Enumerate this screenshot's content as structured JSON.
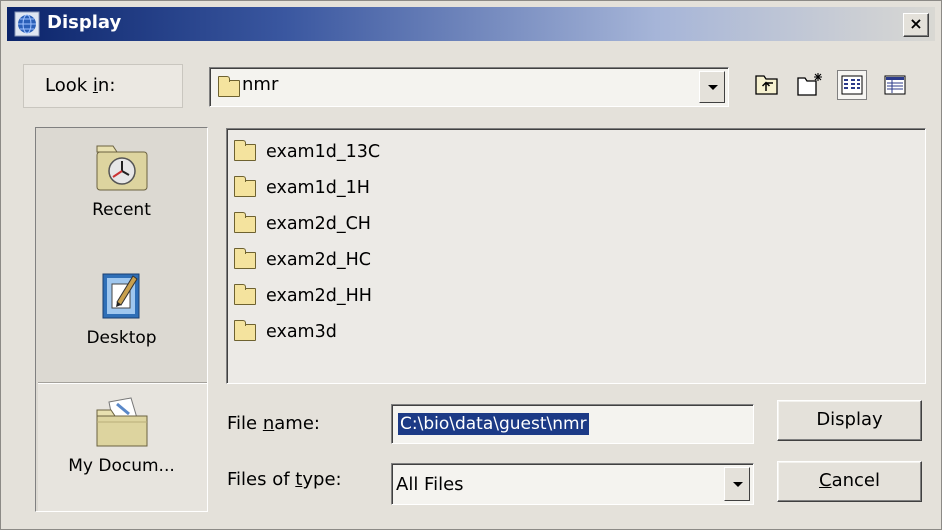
{
  "window": {
    "title": "Display",
    "close_label": "×"
  },
  "look_in": {
    "label_pre": "Look ",
    "label_mnemonic": "i",
    "label_post": "n:",
    "value": "nmr"
  },
  "toolbar": {
    "icons": [
      "up-one-level-icon",
      "create-new-folder-icon",
      "list-view-icon",
      "details-view-icon"
    ]
  },
  "places": [
    {
      "label": "Recent",
      "icon": "recent-clock-icon"
    },
    {
      "label": "Desktop",
      "icon": "desktop-icon"
    },
    {
      "label": "My Docum...",
      "icon": "my-documents-icon"
    }
  ],
  "files": [
    "exam1d_13C",
    "exam1d_1H",
    "exam2d_CH",
    "exam2d_HC",
    "exam2d_HH",
    "exam3d"
  ],
  "file_name": {
    "label_pre": "File ",
    "label_mnemonic": "n",
    "label_post": "ame:",
    "value": "C:\\bio\\data\\guest\\nmr"
  },
  "file_type": {
    "label_pre": "Files of ",
    "label_mnemonic": "t",
    "label_post": "ype:",
    "value": "All Files"
  },
  "buttons": {
    "display_label": "Display",
    "cancel_mnemonic": "C",
    "cancel_rest": "ancel"
  },
  "colors": {
    "title_gradient_start": "#0b246a",
    "selection": "#1c3a86",
    "folder": "#f4e39e",
    "window_bg": "#e4e1da"
  }
}
